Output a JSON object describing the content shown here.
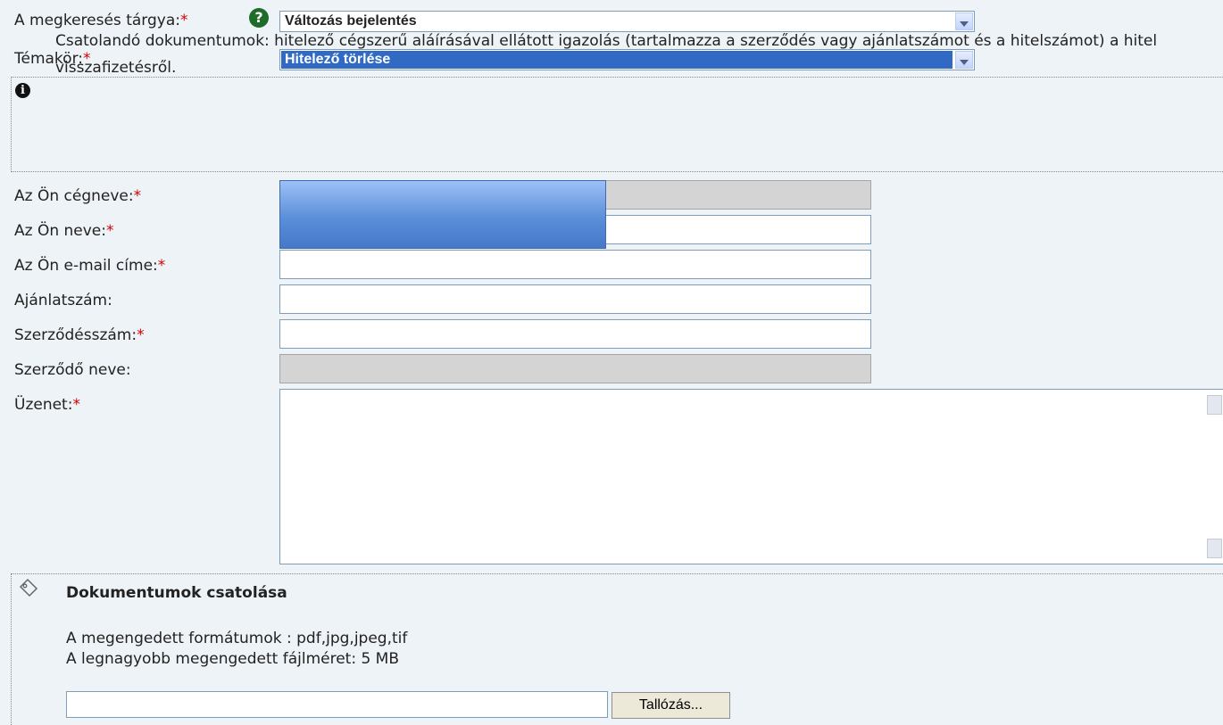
{
  "form": {
    "subject_label": "A megkeresés tárgya:",
    "subject_value": "Változás bejelentés",
    "topic_label": "Témakör:",
    "topic_value": "Hitelező törlése",
    "required_mark": "*",
    "help_icon_glyph": "?",
    "info_text": "Csatolandó dokumentumok: hitelező cégszerű aláírásával ellátott igazolás (tartalmazza a szerződés vagy ajánlatszámot és a hitelszámot) a hitel visszafizetésről.",
    "company_label": "Az Ön cégneve:",
    "name_label": "Az Ön neve:",
    "email_label": "Az Ön e-mail címe:",
    "offer_label": "Ajánlatszám:",
    "contract_label": "Szerződésszám:",
    "contractor_label": "Szerződő neve:",
    "message_label": "Üzenet:",
    "fields": {
      "company": "",
      "name": "",
      "email": "",
      "offer": "",
      "contract": "",
      "contractor": "",
      "message": ""
    }
  },
  "attachments": {
    "title": "Dokumentumok csatolása",
    "formats": "A megengedett formátumok : pdf,jpg,jpeg,tif",
    "max_size": "A legnagyobb megengedett fájlméret: 5 MB",
    "browse_label": "Tallózás..."
  },
  "icons": {
    "help": "help-icon",
    "info": "info-icon",
    "attachment": "paperclip-icon",
    "dropdown": "chevron-down-icon"
  },
  "colors": {
    "background": "#eef3f7",
    "required": "#d40000",
    "selection": "#316ac5",
    "help_icon": "#1e6b2a"
  }
}
